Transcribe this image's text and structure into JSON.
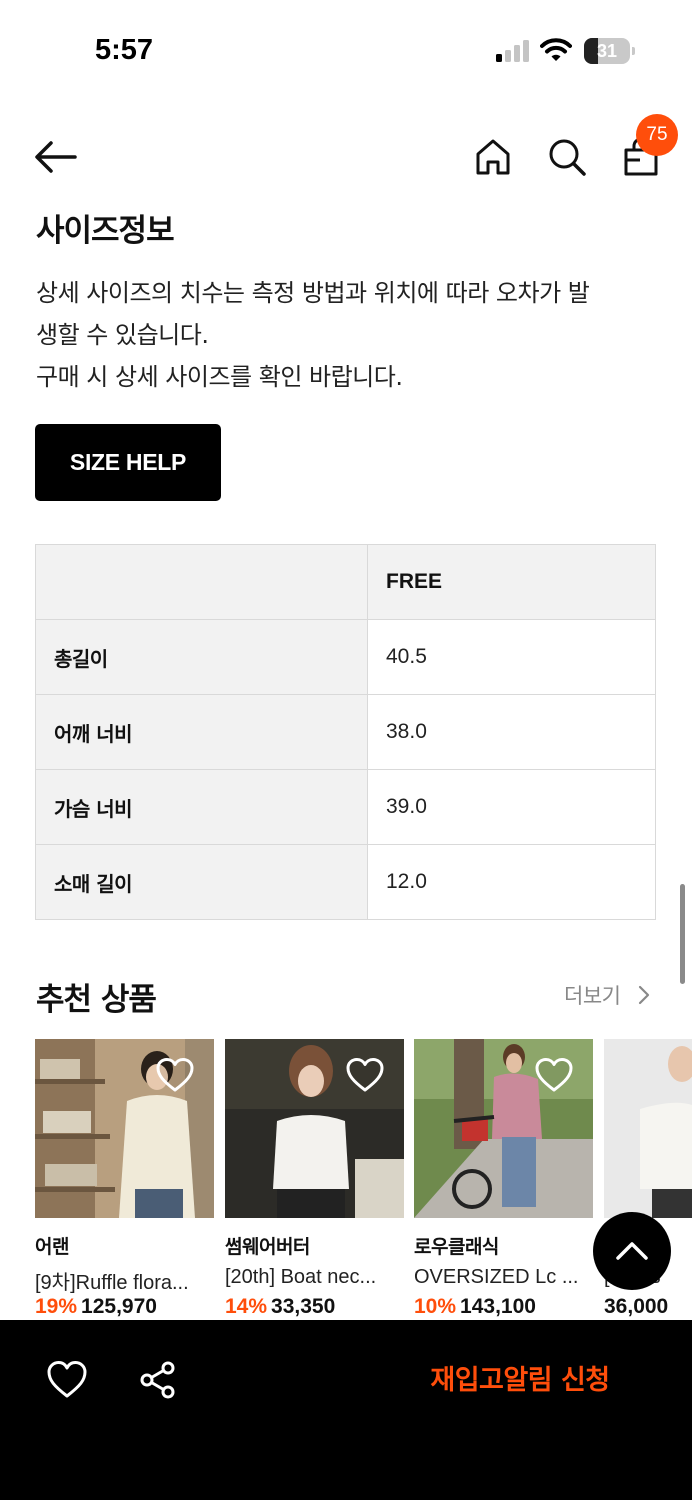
{
  "status_bar": {
    "time": "5:57",
    "battery_level": "31",
    "icons": [
      "signal-icon",
      "wifi-icon",
      "battery-icon"
    ]
  },
  "nav": {
    "icons": [
      "back-arrow-icon",
      "home-icon",
      "search-icon",
      "shopping-bag-icon"
    ],
    "cart_count": "75"
  },
  "size_info": {
    "title": "사이즈정보",
    "description_lines": [
      "상세 사이즈의 치수는 측정 방법과 위치에 따라 오차가 발",
      "생할 수 있습니다.",
      "구매 시 상세 사이즈를 확인 바랍니다."
    ],
    "help_button": "SIZE HELP",
    "table": {
      "header": [
        "",
        "FREE"
      ],
      "rows": [
        [
          "총길이",
          "40.5"
        ],
        [
          "어깨 너비",
          "38.0"
        ],
        [
          "가슴 너비",
          "39.0"
        ],
        [
          "소매 길이",
          "12.0"
        ]
      ]
    }
  },
  "recommended": {
    "title": "추천 상품",
    "more_label": "더보기",
    "products": [
      {
        "brand": "어랜",
        "name": "[9차]Ruffle flora...",
        "discount": "19%",
        "price": "125,970"
      },
      {
        "brand": "썸웨어버터",
        "name": "[20th] Boat nec...",
        "discount": "14%",
        "price": "33,350"
      },
      {
        "brand": "로우클래식",
        "name": "OVERSIZED Lc ...",
        "discount": "10%",
        "price": "143,100"
      },
      {
        "brand": "",
        "name": "[...] Es",
        "discount": "",
        "price": "36,000"
      }
    ]
  },
  "bottom_bar": {
    "icons": [
      "heart-icon",
      "share-icon"
    ],
    "restock_label": "재입고알림 신청"
  },
  "colors": {
    "accent": "#ff4e0b",
    "bottom_bar": "#000000",
    "table_header_bg": "#f2f2f2"
  }
}
